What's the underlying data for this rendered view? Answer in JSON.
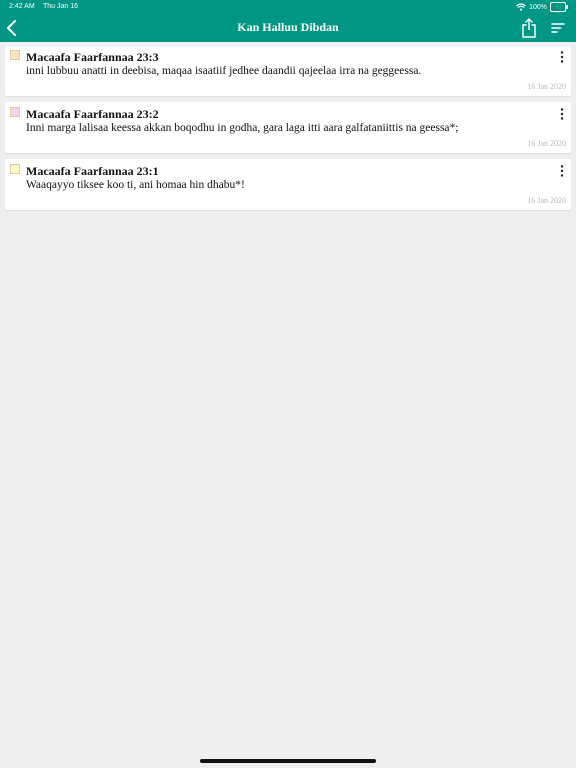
{
  "status_bar": {
    "time": "2:42 AM",
    "date": "Thu Jan 16",
    "battery": "100%"
  },
  "nav": {
    "title": "Kan Halluu Dibdan",
    "back_icon": "chevron-left-icon",
    "share_icon": "share-icon",
    "sort_icon": "sort-icon"
  },
  "colors": {
    "header": "#009684",
    "background": "#efefef"
  },
  "highlights": [
    {
      "title": "Macaafa Faarfannaa 23:3",
      "text": "inni lubbuu anatti in deebisa, maqaa isaatiif jedhee daandii qajeelaa irra na geggeessa.",
      "date": "16 Jan 2020",
      "color": "#fde3bd"
    },
    {
      "title": "Macaafa Faarfannaa 23:2",
      "text": "Inni marga lalisaa keessa akkan boqodhu in godha, gara laga itti aara galfataniittis na geessa*;",
      "date": "16 Jan 2020",
      "color": "#f9d2f2"
    },
    {
      "title": "Macaafa Faarfannaa 23:1",
      "text": "Waaqayyo tiksee koo ti, ani homaa hin dhabu*!",
      "date": "16 Jan 2020",
      "color": "#fdf9c4"
    }
  ]
}
